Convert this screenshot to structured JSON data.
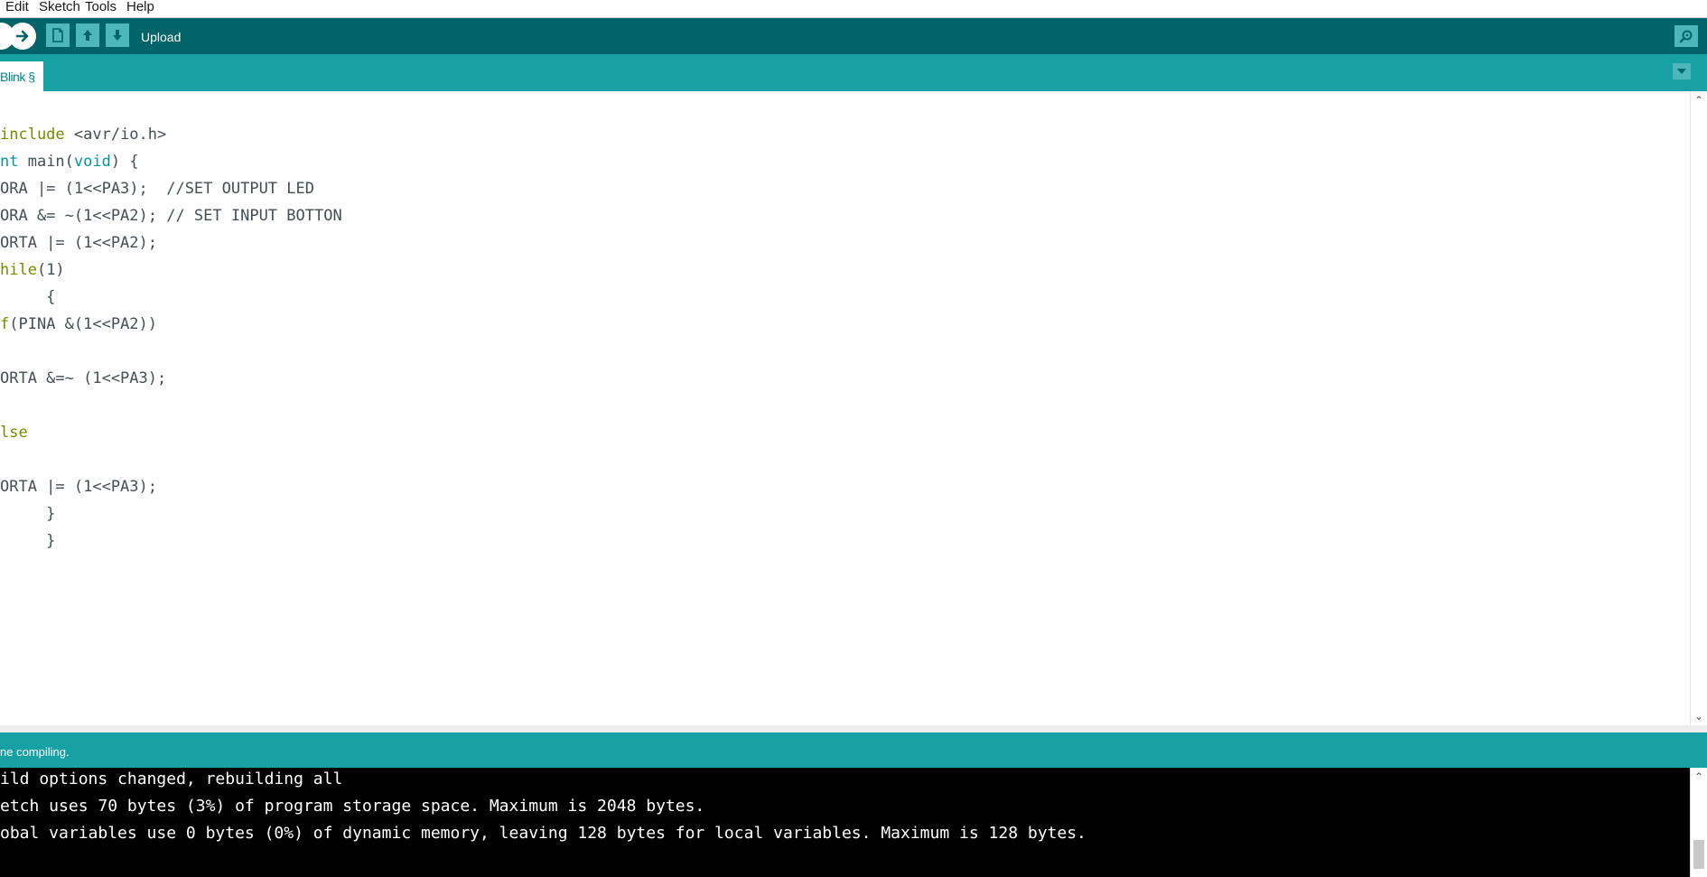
{
  "menu": [
    "Edit",
    "Sketch",
    "Tools",
    "Help"
  ],
  "toolbar": {
    "hover_label": "Upload",
    "icons": [
      "verify-icon",
      "upload-arrow-icon",
      "new-file-icon",
      "open-icon",
      "save-icon",
      "serial-monitor-icon"
    ]
  },
  "tab": {
    "name": "Blink §"
  },
  "editor": {
    "lines": [
      "include <avr/io.h>",
      "nt main(void) {",
      "ORA |= (1<<PA3);  //SET OUTPUT LED",
      "ORA &= ~(1<<PA2); // SET INPUT BOTTON",
      "ORTA |= (1<<PA2);",
      "hile(1)",
      "     {",
      "f(PINA &(1<<PA2))",
      "",
      "ORTA &=~ (1<<PA3);",
      "",
      "lse",
      "",
      "ORTA |= (1<<PA3);",
      "     }",
      "     }"
    ]
  },
  "status": {
    "message": "ne compiling."
  },
  "console": {
    "lines": [
      "ild options changed, rebuilding all",
      "etch uses 70 bytes (3%) of program storage space. Maximum is 2048 bytes.",
      "obal variables use 0 bytes (0%) of dynamic memory, leaving 128 bytes for local variables. Maximum is 128 bytes."
    ]
  },
  "colors": {
    "toolbar": "#006468",
    "tabbar": "#17a1a5",
    "keyword_green": "#728e00",
    "keyword_teal": "#00979c",
    "text": "#434f54"
  }
}
